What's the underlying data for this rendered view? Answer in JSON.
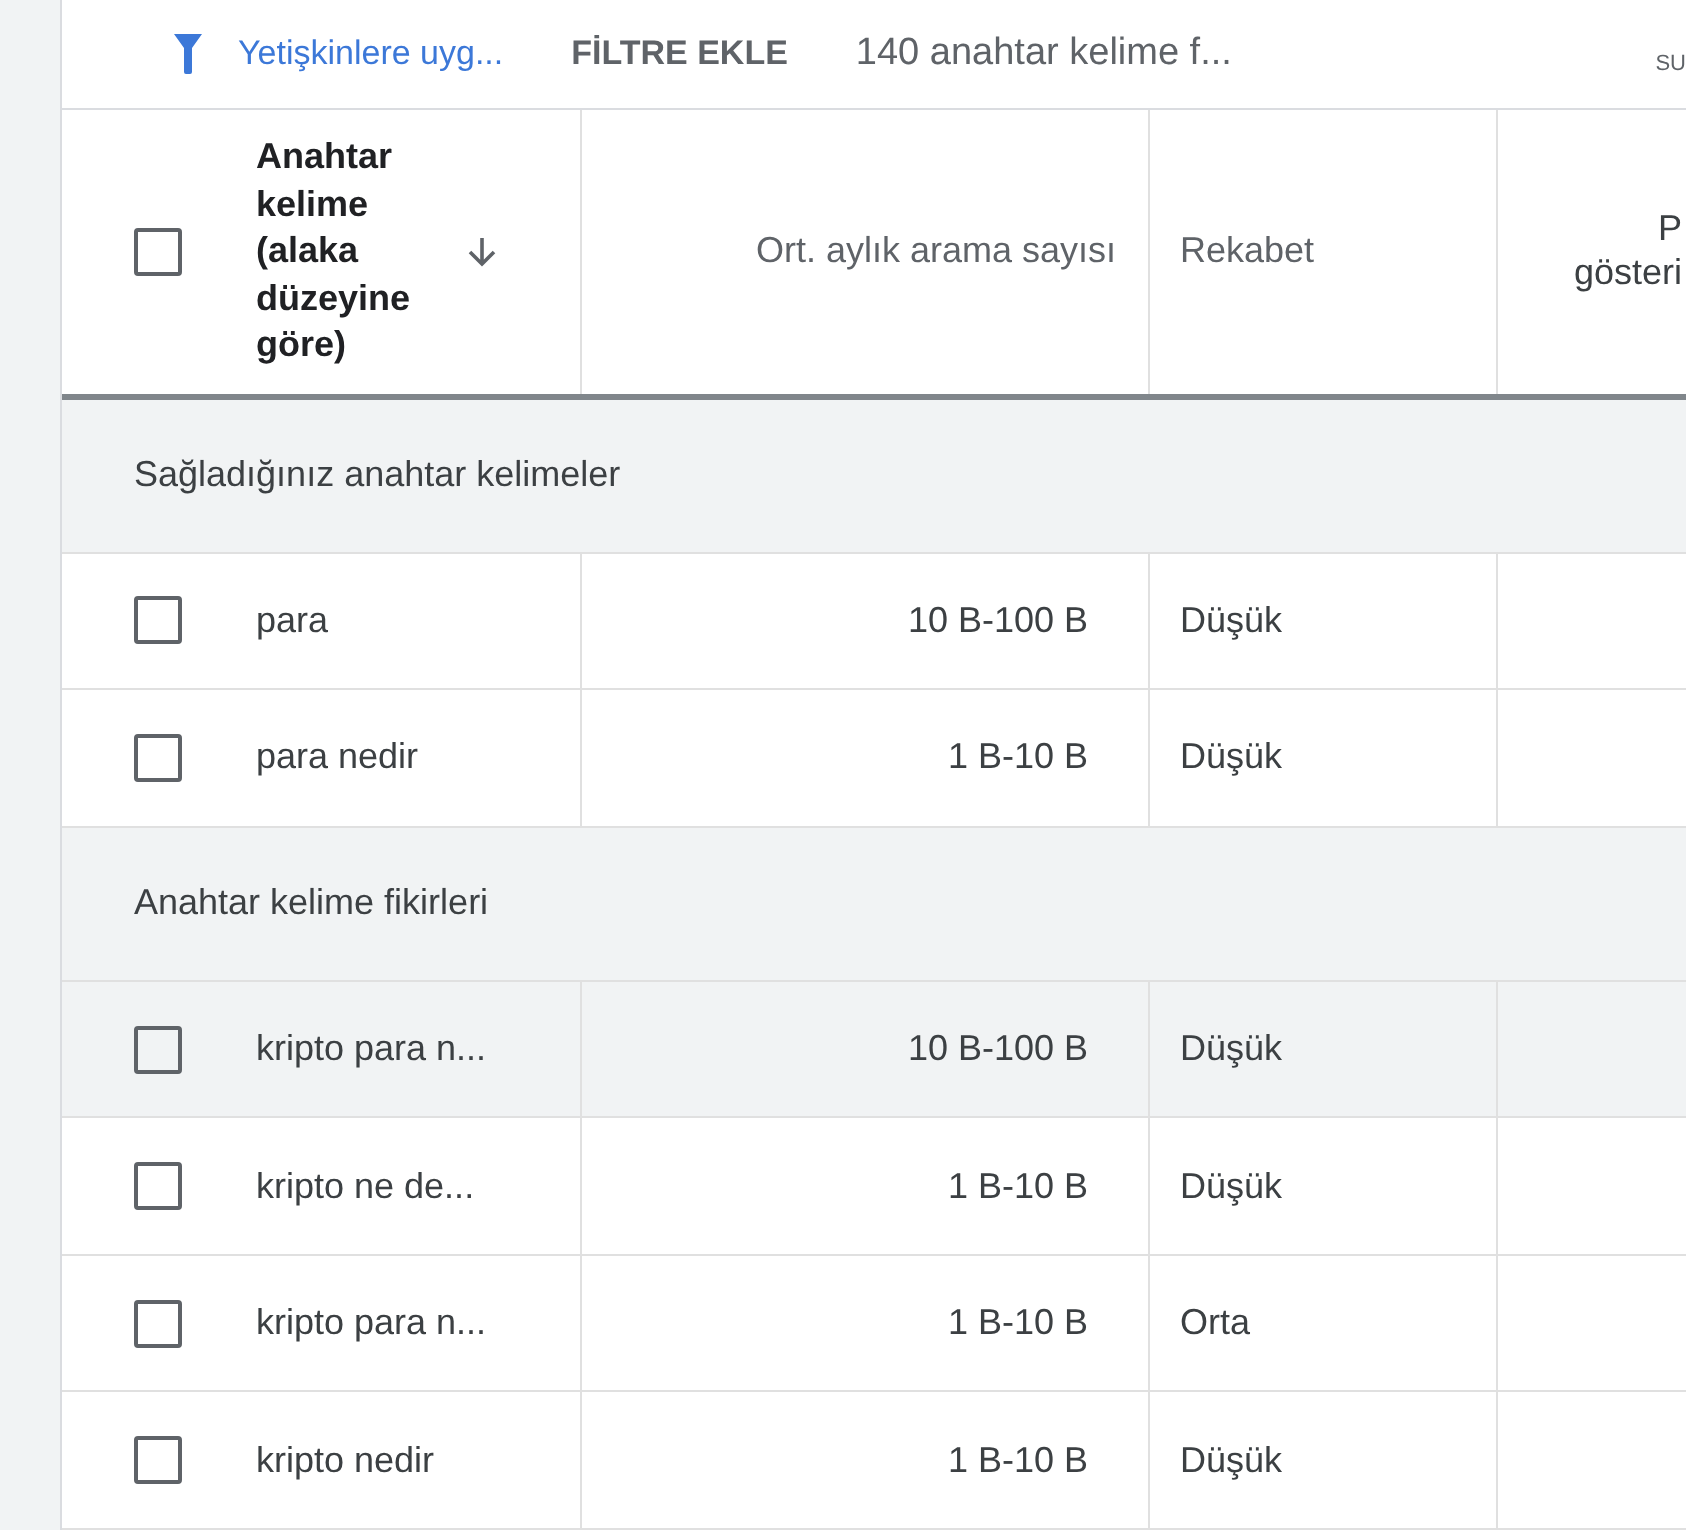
{
  "toolbar": {
    "filter_chip": "Yetişkinlere uyg...",
    "add_filter": "FİLTRE EKLE",
    "keyword_count": "140 anahtar kelime f...",
    "column_5": "SU"
  },
  "table": {
    "select_all_checked": false,
    "columns": [
      {
        "label": "Anahtar kelime (alaka düzeyine göre)",
        "sorted": true
      },
      {
        "label": "Ort. aylık arama sayısı",
        "sorted": false
      },
      {
        "label": "Rekabet",
        "sorted": false
      },
      {
        "label": "P\ngösteri",
        "sorted": false
      }
    ],
    "groups": [
      {
        "title": "Sağladığınız anahtar kelimeler",
        "rows": [
          {
            "keyword": "para",
            "searches": "10 B-100 B",
            "competition": "Düşük",
            "checked": false,
            "highlighted": false
          },
          {
            "keyword": "para nedir",
            "searches": "1 B-10 B",
            "competition": "Düşük",
            "checked": false,
            "highlighted": false
          }
        ]
      },
      {
        "title": "Anahtar kelime fikirleri",
        "rows": [
          {
            "keyword": "kripto para n...",
            "searches": "10 B-100 B",
            "competition": "Düşük",
            "checked": false,
            "highlighted": true
          },
          {
            "keyword": "kripto ne de...",
            "searches": "1 B-10 B",
            "competition": "Düşük",
            "checked": false,
            "highlighted": false
          },
          {
            "keyword": "kripto para n...",
            "searches": "1 B-10 B",
            "competition": "Orta",
            "checked": false,
            "highlighted": false
          },
          {
            "keyword": "kripto nedir",
            "searches": "1 B-10 B",
            "competition": "Düşük",
            "checked": false,
            "highlighted": false
          }
        ]
      }
    ]
  }
}
